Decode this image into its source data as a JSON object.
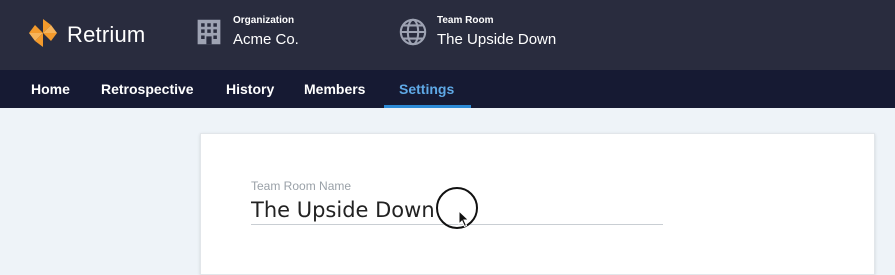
{
  "brand": {
    "name": "Retrium",
    "logo_icon": "retrium-pinwheel-icon",
    "accent": "#f39a2c"
  },
  "header": {
    "organization": {
      "caption": "Organization",
      "value": "Acme Co.",
      "icon": "building-icon"
    },
    "team_room": {
      "caption": "Team Room",
      "value": "The Upside Down",
      "icon": "globe-icon"
    }
  },
  "nav": {
    "tabs": [
      {
        "label": "Home"
      },
      {
        "label": "Retrospective"
      },
      {
        "label": "History"
      },
      {
        "label": "Members"
      },
      {
        "label": "Settings",
        "active": true
      }
    ],
    "active_color": "#5fa9e6"
  },
  "settings": {
    "team_room_name": {
      "label": "Team Room Name",
      "value": "The Upside Down"
    }
  },
  "colors": {
    "topbar": "#292c3e",
    "navbar": "#161a33",
    "page_bg": "#eef3f8"
  }
}
